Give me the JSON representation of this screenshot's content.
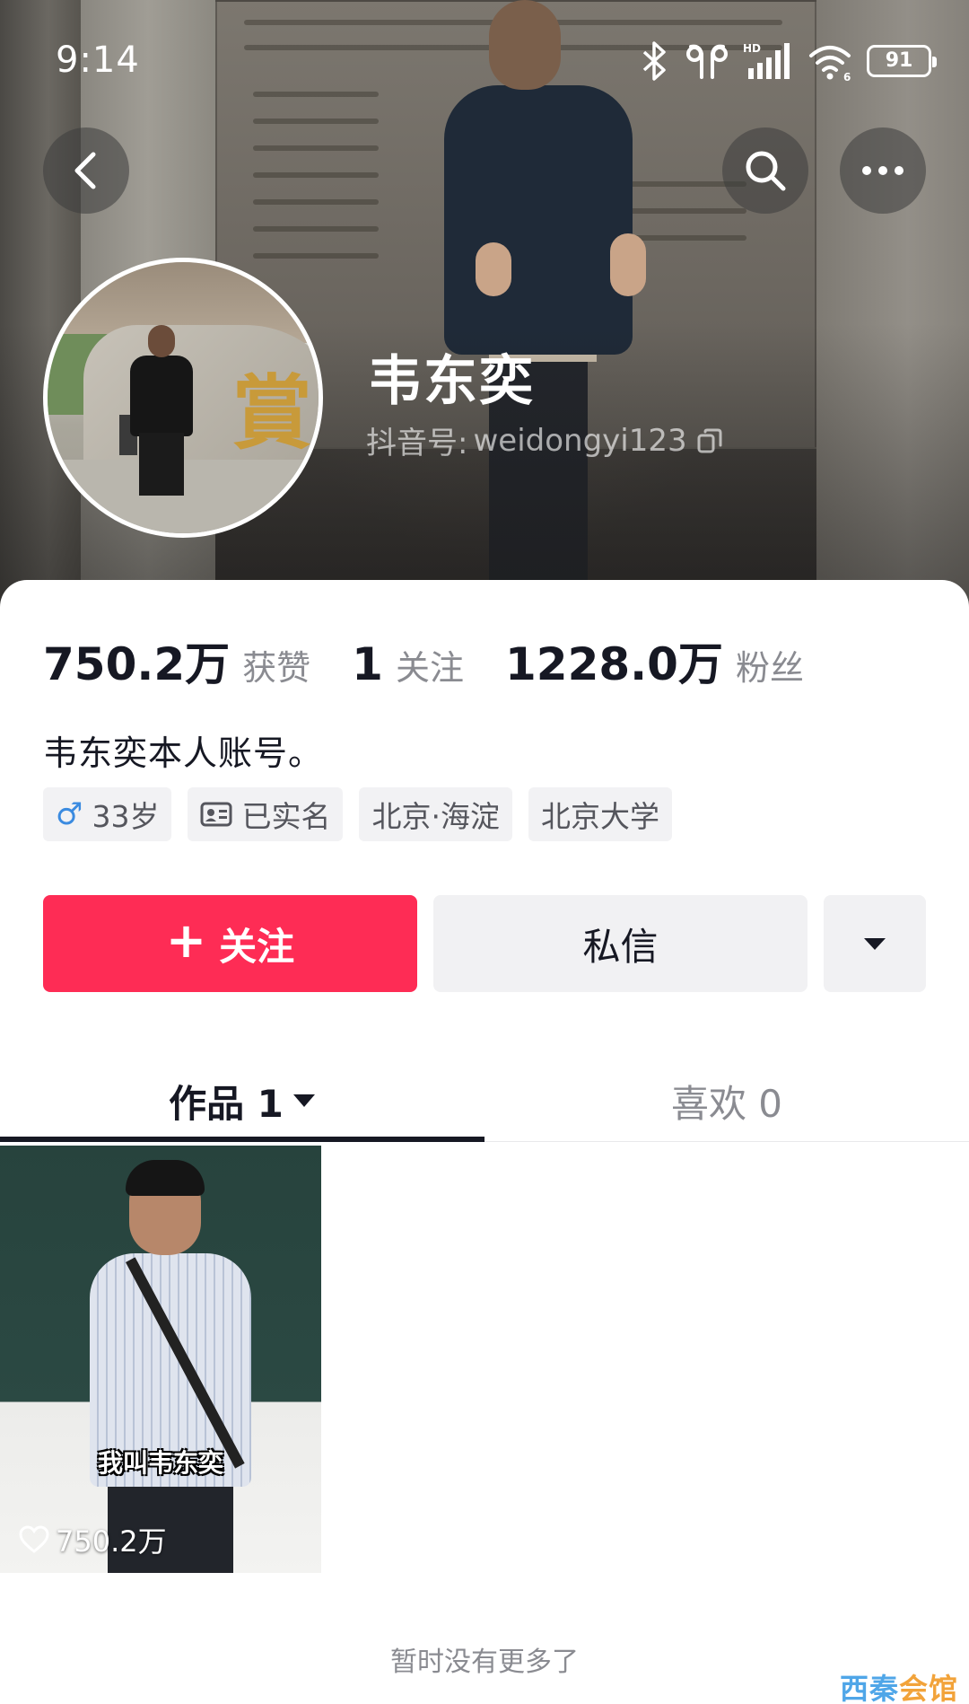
{
  "status_bar": {
    "time": "9:14",
    "battery": "91",
    "icons": [
      "bluetooth-icon",
      "earbuds-icon",
      "hd-signal-icon",
      "wifi-icon",
      "battery-icon"
    ]
  },
  "header": {
    "back_icon": "chevron-left-icon",
    "search_icon": "search-icon",
    "more_icon": "more-dots-icon"
  },
  "profile": {
    "display_name": "韦东奕",
    "handle_label": "抖音号:",
    "handle": "weidongyi123",
    "bio": "韦东奕本人账号。"
  },
  "stats": [
    {
      "value": "750.2万",
      "label": "获赞"
    },
    {
      "value": "1",
      "label": "关注"
    },
    {
      "value": "1228.0万",
      "label": "粉丝"
    }
  ],
  "tags": {
    "gender_symbol": "♂",
    "age": "33岁",
    "verified": "已实名",
    "location": "北京·海淀",
    "school": "北京大学"
  },
  "actions": {
    "follow_plus": "+",
    "follow": "关注",
    "message": "私信"
  },
  "tabs": {
    "works": "作品 1",
    "likes": "喜欢 0"
  },
  "videos": [
    {
      "caption": "我叫韦东奕",
      "likes": "750.2万"
    }
  ],
  "footer": {
    "no_more": "暂时没有更多了"
  },
  "watermark": {
    "part1": "西秦",
    "part2": "会馆"
  },
  "colors": {
    "follow_button": "#fe2c55",
    "text_primary": "#161823",
    "text_secondary": "#8a8b91",
    "gender_blue": "#3b8be0"
  }
}
